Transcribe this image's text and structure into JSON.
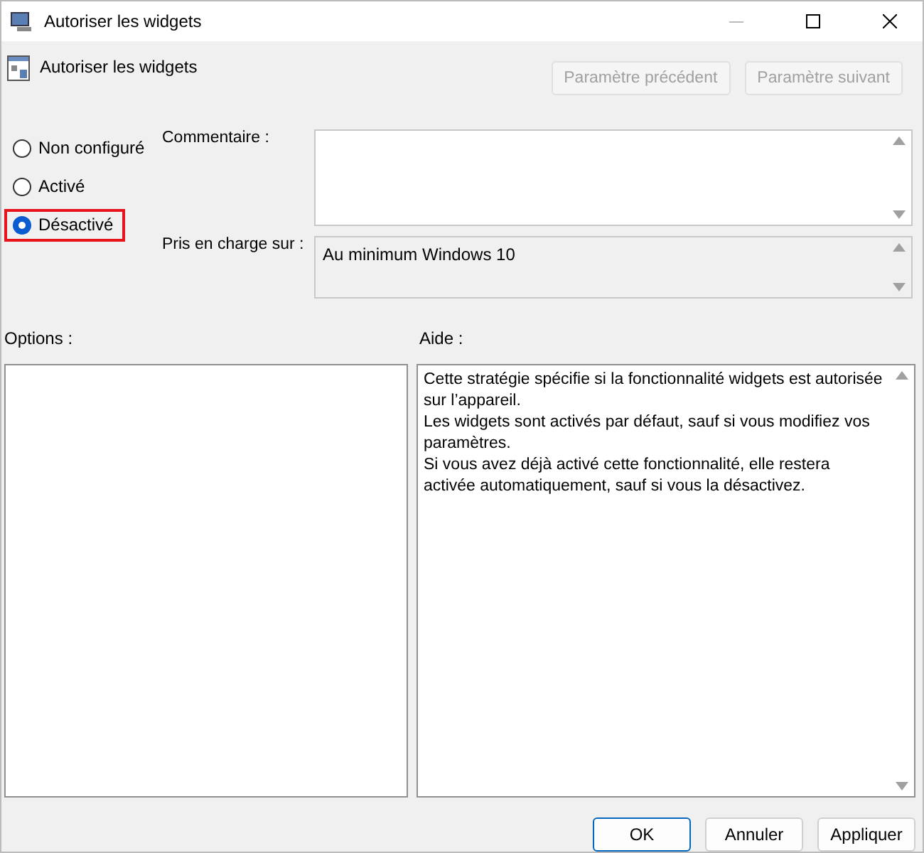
{
  "window": {
    "title": "Autoriser les widgets"
  },
  "header": {
    "title": "Autoriser les widgets",
    "buttons": [
      {
        "label": "Paramètre précédent",
        "disabled": true
      },
      {
        "label": "Paramètre suivant",
        "disabled": true
      }
    ]
  },
  "options": [
    {
      "label": "Non configuré",
      "selected": false,
      "highlighted": false
    },
    {
      "label": "Activé",
      "selected": false,
      "highlighted": false
    },
    {
      "label": "Désactivé",
      "selected": true,
      "highlighted": true
    }
  ],
  "comment": {
    "label": "Commentaire :"
  },
  "supported": {
    "label": "Pris en charge sur :",
    "value": "Au minimum Windows 10"
  },
  "options_pane": {
    "label": "Options :"
  },
  "help": {
    "label": "Aide :",
    "paragraphs": [
      "Cette stratégie spécifie si la fonctionnalité widgets est autorisée sur l’appareil.",
      "Les widgets sont activés par défaut, sauf si vous modifiez vos paramètres.",
      "Si vous avez déjà activé cette fonctionnalité, elle restera activée automatiquement, sauf si vous la désactivez."
    ]
  },
  "buttons": [
    {
      "label": "OK",
      "default": true
    },
    {
      "label": "Annuler",
      "default": false
    },
    {
      "label": "Appliquer",
      "default": false
    }
  ]
}
